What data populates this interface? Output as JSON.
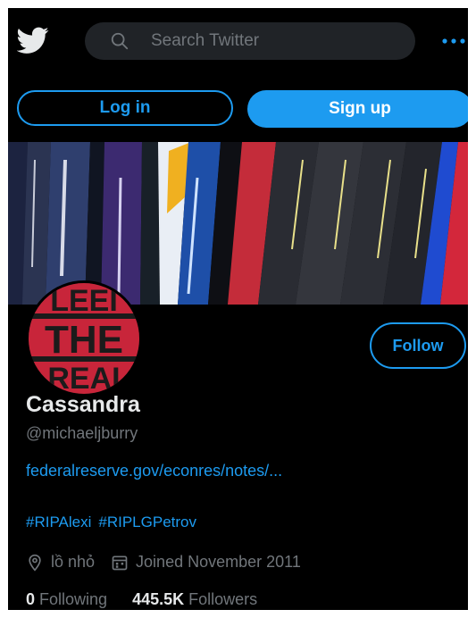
{
  "topbar": {
    "search_placeholder": "Search Twitter"
  },
  "auth": {
    "login_label": "Log in",
    "signup_label": "Sign up"
  },
  "profile": {
    "display_name": "Cassandra",
    "handle": "@michaeljburry",
    "website": "federalreserve.gov/econres/notes/...",
    "hashtags": [
      "#RIPAlexi",
      "#RIPLGPetrov"
    ],
    "location": "lồ nhỏ",
    "joined": "Joined November 2011",
    "follow_label": "Follow",
    "following_count": "0",
    "following_label": "Following",
    "followers_count": "445.5K",
    "followers_label": "Followers",
    "avatar_text": [
      "LEEI",
      "THE",
      "REAI"
    ]
  },
  "colors": {
    "accent": "#1d9bf0",
    "background": "#000000",
    "muted_text": "#71767b"
  },
  "icons": {
    "logo": "twitter-bird-icon",
    "search": "search-icon",
    "more": "more-dots-icon",
    "location": "location-pin-icon",
    "calendar": "calendar-icon"
  }
}
